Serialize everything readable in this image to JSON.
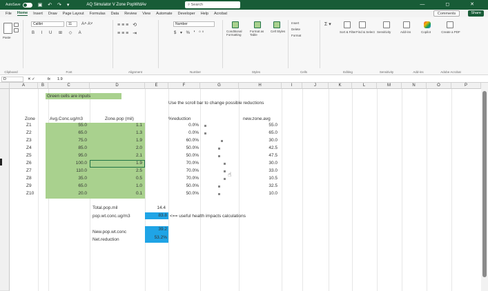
{
  "titlebar": {
    "autosave": "AutoSave",
    "toggle_state": "Off",
    "filename": "AQ Simulator V Zone PopWtdAv",
    "search_placeholder": "Search",
    "window_buttons": "— ◻ ✕"
  },
  "tabs": [
    "File",
    "Home",
    "Insert",
    "Draw",
    "Page Layout",
    "Formulas",
    "Data",
    "Review",
    "View",
    "Automate",
    "Developer",
    "Help",
    "Acrobat"
  ],
  "tabs_right": {
    "comments": "Comments",
    "share": "Share"
  },
  "ribbon": {
    "paste": "Paste",
    "font_name": "Calibri",
    "font_size": "11",
    "number_format": "Number",
    "conditional_formatting": "Conditional Formatting",
    "format_as_table": "Format as Table",
    "cell_styles": "Cell Styles",
    "insert": "Insert",
    "delete": "Delete",
    "format": "Format",
    "sort_filter": "Sort & Filter",
    "find_select": "Find & Select",
    "sensitivity": "Sensitivity",
    "add_ins": "Add-ins",
    "copilot": "Copilot",
    "create_pdf": "Create a PDF",
    "groups": [
      "Clipboard",
      "Font",
      "Alignment",
      "Number",
      "Styles",
      "Cells",
      "Editing",
      "Sensitivity",
      "Add-ins",
      "Adobe Acrobat"
    ]
  },
  "formula_bar": {
    "name_box": "D",
    "fx": "fx",
    "value": "1.9"
  },
  "columns": [
    "A",
    "B",
    "C",
    "D",
    "E",
    "F",
    "G",
    "H",
    "I",
    "J",
    "K",
    "L",
    "M",
    "N",
    "O",
    "P"
  ],
  "sheet": {
    "green_note": "Green cells are inputs",
    "scroll_note": "Use the scroll bar to change possible reductions",
    "headers": {
      "zone": "Zone",
      "conc": "Avg.Conc.ug/m3",
      "pop": "Zone.pop (mil)",
      "reduction": "%reduction",
      "new_avg": "new.zone.avg"
    },
    "zones": [
      "Z1",
      "Z2",
      "Z3",
      "Z4",
      "Z5",
      "Z6",
      "Z7",
      "Z8",
      "Z9",
      "Z10"
    ],
    "conc": [
      "55.0",
      "65.0",
      "75.0",
      "85.0",
      "95.0",
      "100.0",
      "110.0",
      "35.0",
      "65.0",
      "20.0"
    ],
    "pop": [
      "1.1",
      "1.3",
      "1.9",
      "2.0",
      "2.1",
      "1.9",
      "2.5",
      "0.5",
      "1.0",
      "0.1"
    ],
    "reduction": [
      "0.0%",
      "0.0%",
      "60.0%",
      "50.0%",
      "50.0%",
      "70.0%",
      "70.0%",
      "70.0%",
      "50.0%",
      "50.0%"
    ],
    "new_avg": [
      "55.0",
      "65.0",
      "30.0",
      "42.5",
      "47.5",
      "30.0",
      "33.0",
      "10.5",
      "32.5",
      "10.0"
    ],
    "scroll_levels": [
      0.0,
      0.0,
      0.6,
      0.5,
      0.5,
      0.7,
      0.7,
      0.7,
      0.5,
      0.5
    ],
    "total_pop_label": "Total.pop.mil",
    "total_pop_value": "14.4",
    "pop_wt_label": "pop.wt.conc.ug/m3",
    "pop_wt_value": "83.8",
    "useful_note": "<== useful health impacts calculations",
    "new_pop_label": "New.pop.wt.conc",
    "new_pop_value": "39.2",
    "net_red_label": "Net.reduction",
    "net_red_value": "53.2%"
  }
}
